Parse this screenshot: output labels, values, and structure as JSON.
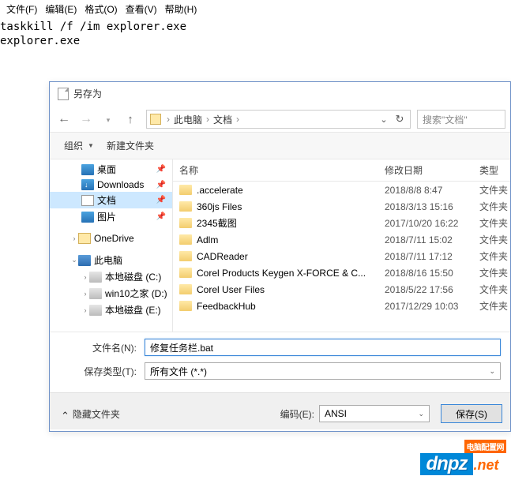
{
  "notepad": {
    "menu": {
      "file": "文件(F)",
      "edit": "编辑(E)",
      "format": "格式(O)",
      "view": "查看(V)",
      "help": "帮助(H)"
    },
    "content": "taskkill /f /im explorer.exe\nexplorer.exe"
  },
  "dialog": {
    "title": "另存为",
    "breadcrumb": {
      "thispc": "此电脑",
      "docs": "文档"
    },
    "search_placeholder": "搜索\"文档\"",
    "toolbar": {
      "organize": "组织",
      "newfolder": "新建文件夹"
    },
    "sidebar": {
      "desktop": "桌面",
      "downloads": "Downloads",
      "documents": "文档",
      "pictures": "图片",
      "onedrive": "OneDrive",
      "thispc": "此电脑",
      "drive_c": "本地磁盘 (C:)",
      "drive_d": "win10之家 (D:)",
      "drive_last_partial": "本地磁盘 (E:)"
    },
    "columns": {
      "name": "名称",
      "date": "修改日期",
      "type": "类型"
    },
    "files": [
      {
        "name": ".accelerate",
        "date": "2018/8/8 8:47",
        "type": "文件夹"
      },
      {
        "name": "360js Files",
        "date": "2018/3/13 15:16",
        "type": "文件夹"
      },
      {
        "name": "2345截图",
        "date": "2017/10/20 16:22",
        "type": "文件夹"
      },
      {
        "name": "Adlm",
        "date": "2018/7/11 15:02",
        "type": "文件夹"
      },
      {
        "name": "CADReader",
        "date": "2018/7/11 17:12",
        "type": "文件夹"
      },
      {
        "name": "Corel Products Keygen X-FORCE & C...",
        "date": "2018/8/16 15:50",
        "type": "文件夹"
      },
      {
        "name": "Corel User Files",
        "date": "2018/5/22 17:56",
        "type": "文件夹"
      },
      {
        "name": "FeedbackHub",
        "date": "2017/12/29 10:03",
        "type": "文件夹"
      }
    ],
    "filename_label": "文件名(N):",
    "filename_value": "修复任务栏.bat",
    "savetype_label": "保存类型(T):",
    "savetype_value": "所有文件  (*.*)",
    "hide_folders": "隐藏文件夹",
    "encoding_label": "编码(E):",
    "encoding_value": "ANSI",
    "save_btn": "保存(S)"
  },
  "watermark": {
    "top": "电脑配置网",
    "logo": "dnpz",
    "suffix": ".net"
  }
}
